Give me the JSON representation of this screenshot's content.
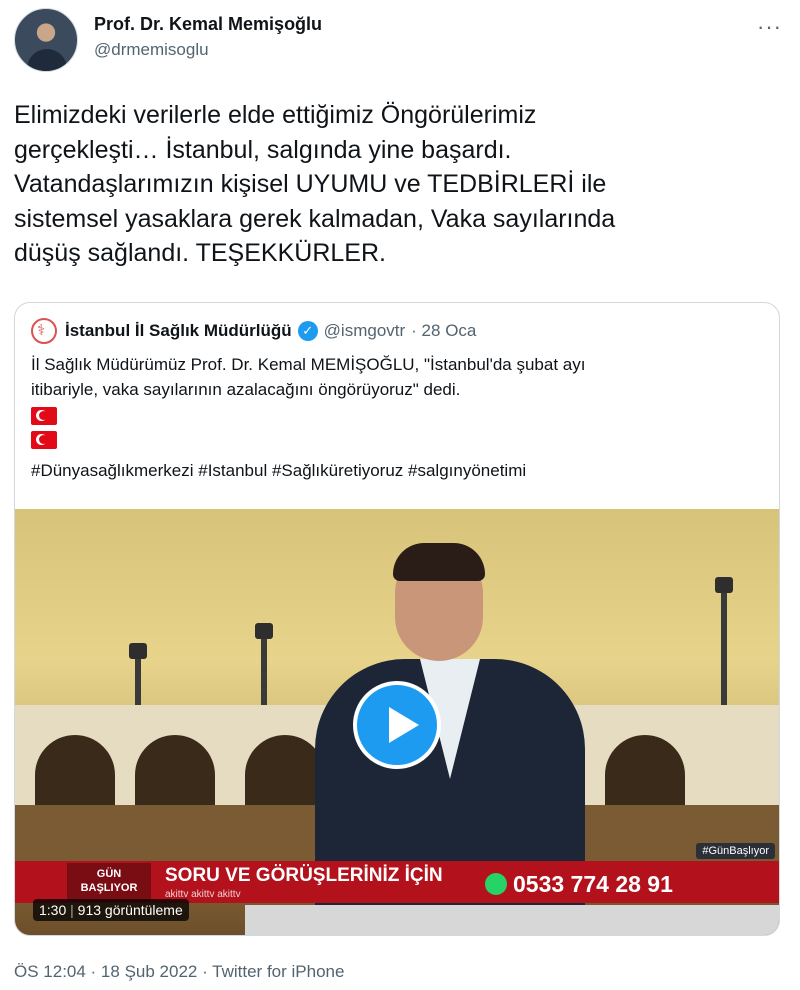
{
  "author": {
    "name": "Prof. Dr. Kemal Memişoğlu",
    "handle": "@drmemisoglu",
    "more_icon": "more-icon"
  },
  "tweet": {
    "text": "Elimizdeki verilerle elde ettiğimiz Öngörülerimiz\ngerçekleşti… İstanbul, salgında yine başardı.\nVatandaşlarımızın kişisel UYUMU ve TEDBİRLERİ ile\nsistemsel yasaklara gerek kalmadan, Vaka sayılarında\ndüşüş sağlandı. TEŞEKKÜRLER."
  },
  "quoted": {
    "name": "İstanbul İl Sağlık Müdürlüğü",
    "handle": "@ismgovtr",
    "date": "· 28 Oca",
    "text": "İl Sağlık Müdürümüz Prof. Dr. Kemal MEMİŞOĞLU, \"İstanbul'da şubat ayı\nitibariyle, vaka sayılarının azalacağını öngörüyoruz\" dedi.",
    "hashtags": "#Dünyasağlıkmerkezi #Istanbul #Sağlıküretiyoruz #salgınyönetimi",
    "media": {
      "ticker_logo": "GÜN\nBAŞLIYOR",
      "ticker_text": "SORU VE GÖRÜŞLERİNİZ İÇİN",
      "ticker_social": "akittv  akittv  akittv",
      "ticker_phone": "0533 774 28 91",
      "hashtag_tag": "#GünBaşlıyor",
      "duration": "1:30",
      "views": "913 görüntüleme"
    }
  },
  "footer": {
    "timestamp": "ÖS 12:04 · 18 Şub 2022 · Twitter for iPhone"
  }
}
